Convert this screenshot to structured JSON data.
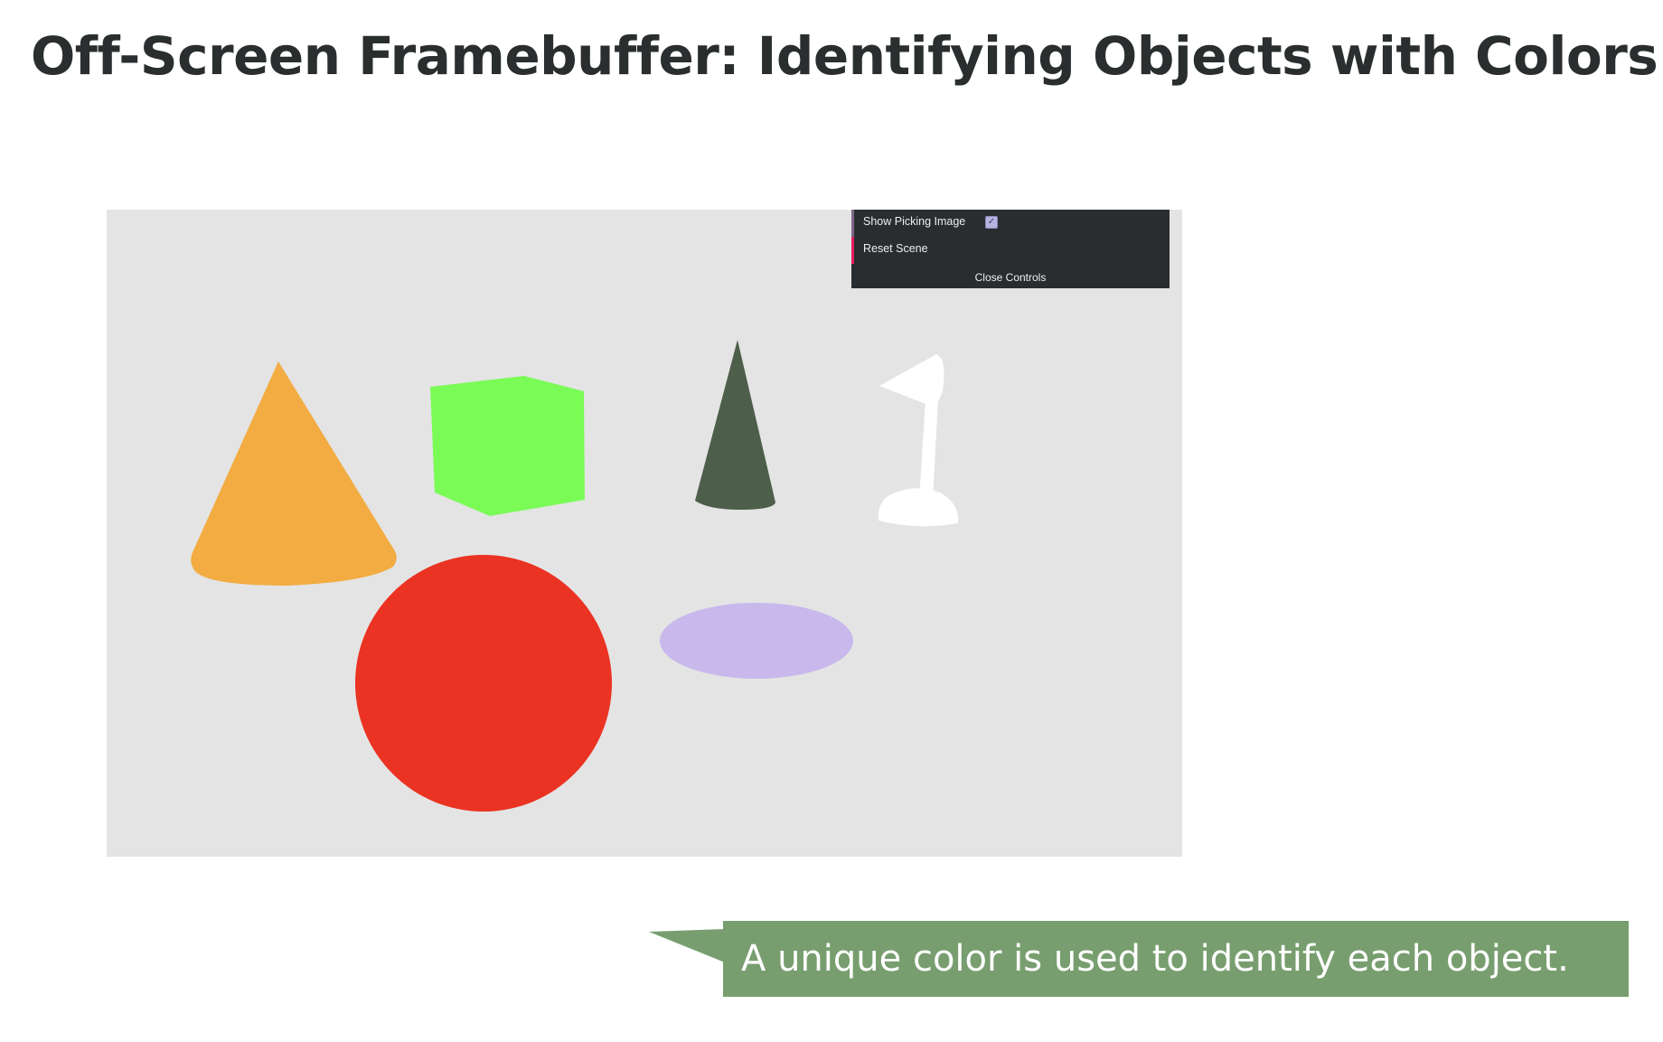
{
  "title": "Off-Screen Framebuffer: Identifying Objects with Colors",
  "gui": {
    "show_picking_image_label": "Show Picking Image",
    "show_picking_image_checked": true,
    "reset_scene_label": "Reset Scene",
    "close_controls_label": "Close Controls"
  },
  "scene": {
    "background": "#e4e4e4",
    "objects": [
      {
        "name": "orange-cone",
        "color": "#f2ac42"
      },
      {
        "name": "green-cube",
        "color": "#7afb56"
      },
      {
        "name": "dark-green-cone",
        "color": "#4d5e4a"
      },
      {
        "name": "white-lamp",
        "color": "#ffffff"
      },
      {
        "name": "red-sphere",
        "color": "#eb3323"
      },
      {
        "name": "lavender-disc",
        "color": "#c8b8ec"
      }
    ]
  },
  "callout": {
    "text": "A unique color is used to identify each object.",
    "color": "#789e6f"
  }
}
